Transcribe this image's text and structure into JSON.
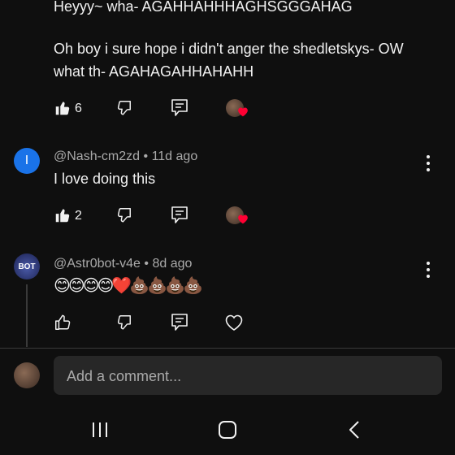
{
  "comment1": {
    "text_line1": "Heyyy~ wha- AGAHHAHHHAGHSGGGAHAG",
    "text_line2": "Oh boy i sure hope i didn't anger the shedletskys- OW",
    "text_line3": "what th- AGAHAGAHHAHAHH",
    "likes": "6"
  },
  "comment2": {
    "avatar_letter": "I",
    "author": "@Nash-cm2zd",
    "age": "11d ago",
    "text": "I love doing this",
    "likes": "2"
  },
  "comment3": {
    "avatar_text": "BOT",
    "author": "@Astr0bot-v4e",
    "age": "8d ago",
    "text": "😊😊😊😊❤️💩💩💩💩"
  },
  "composer": {
    "placeholder": "Add a comment..."
  },
  "colors": {
    "background": "#0f0f0f",
    "avatar_blue": "#1a73e8",
    "heart_red": "#ff0033",
    "input_bg": "#272727"
  }
}
